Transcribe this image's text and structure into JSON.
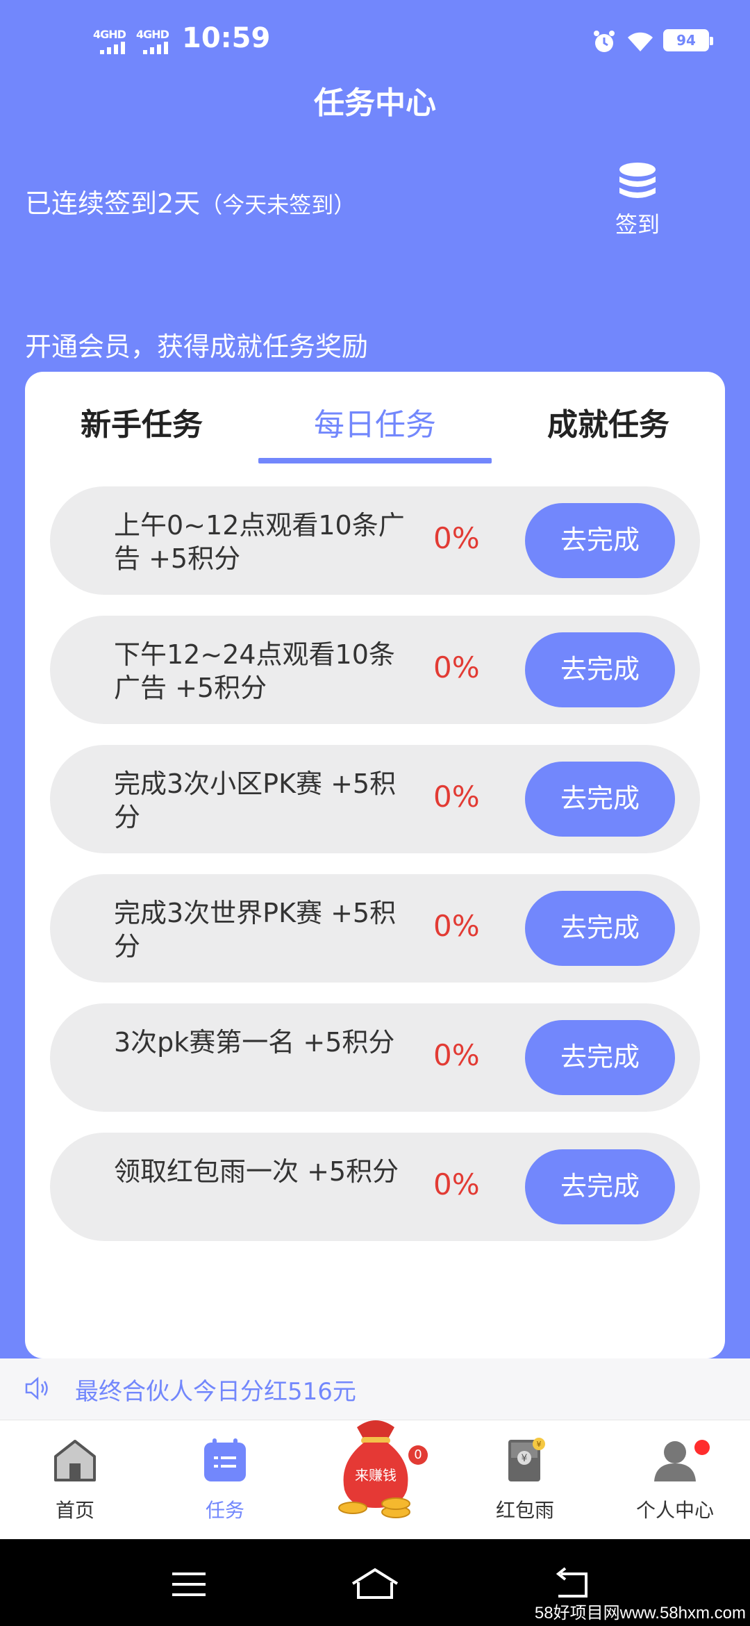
{
  "status_bar": {
    "signal1": "4GHD",
    "signal2": "4GHD",
    "time": "10:59",
    "battery": "94"
  },
  "header": {
    "title": "任务中心"
  },
  "signin": {
    "status_main": "已连续签到2天",
    "status_sub": "（今天未签到）",
    "button_label": "签到"
  },
  "member_tip": "开通会员，获得成就任务奖励",
  "tabs": [
    {
      "label": "新手任务"
    },
    {
      "label": "每日任务"
    },
    {
      "label": "成就任务"
    }
  ],
  "tasks": [
    {
      "name": "上午0~12点观看10条广告  +5积分",
      "progress": "0%",
      "action": "去完成"
    },
    {
      "name": "下午12~24点观看10条广告  +5积分",
      "progress": "0%",
      "action": "去完成"
    },
    {
      "name": "完成3次小区PK赛  +5积分",
      "progress": "0%",
      "action": "去完成"
    },
    {
      "name": "完成3次世界PK赛  +5积分",
      "progress": "0%",
      "action": "去完成"
    },
    {
      "name": "3次pk赛第一名  +5积分",
      "progress": "0%",
      "action": "去完成"
    },
    {
      "name": "领取红包雨一次  +5积分",
      "progress": "0%",
      "action": "去完成"
    }
  ],
  "notice": "最终合伙人今日分红516元",
  "bottom_nav": {
    "items": [
      {
        "label": "首页",
        "icon": "home-icon"
      },
      {
        "label": "任务",
        "icon": "task-icon"
      },
      {
        "label": "来赚钱",
        "icon": "money-bag-icon",
        "badge": "0"
      },
      {
        "label": "红包雨",
        "icon": "red-envelope-icon"
      },
      {
        "label": "个人中心",
        "icon": "profile-icon"
      }
    ]
  },
  "watermark": "58好项目网www.58hxm.com",
  "colors": {
    "accent": "#7287fc",
    "progress": "#e23b34"
  }
}
